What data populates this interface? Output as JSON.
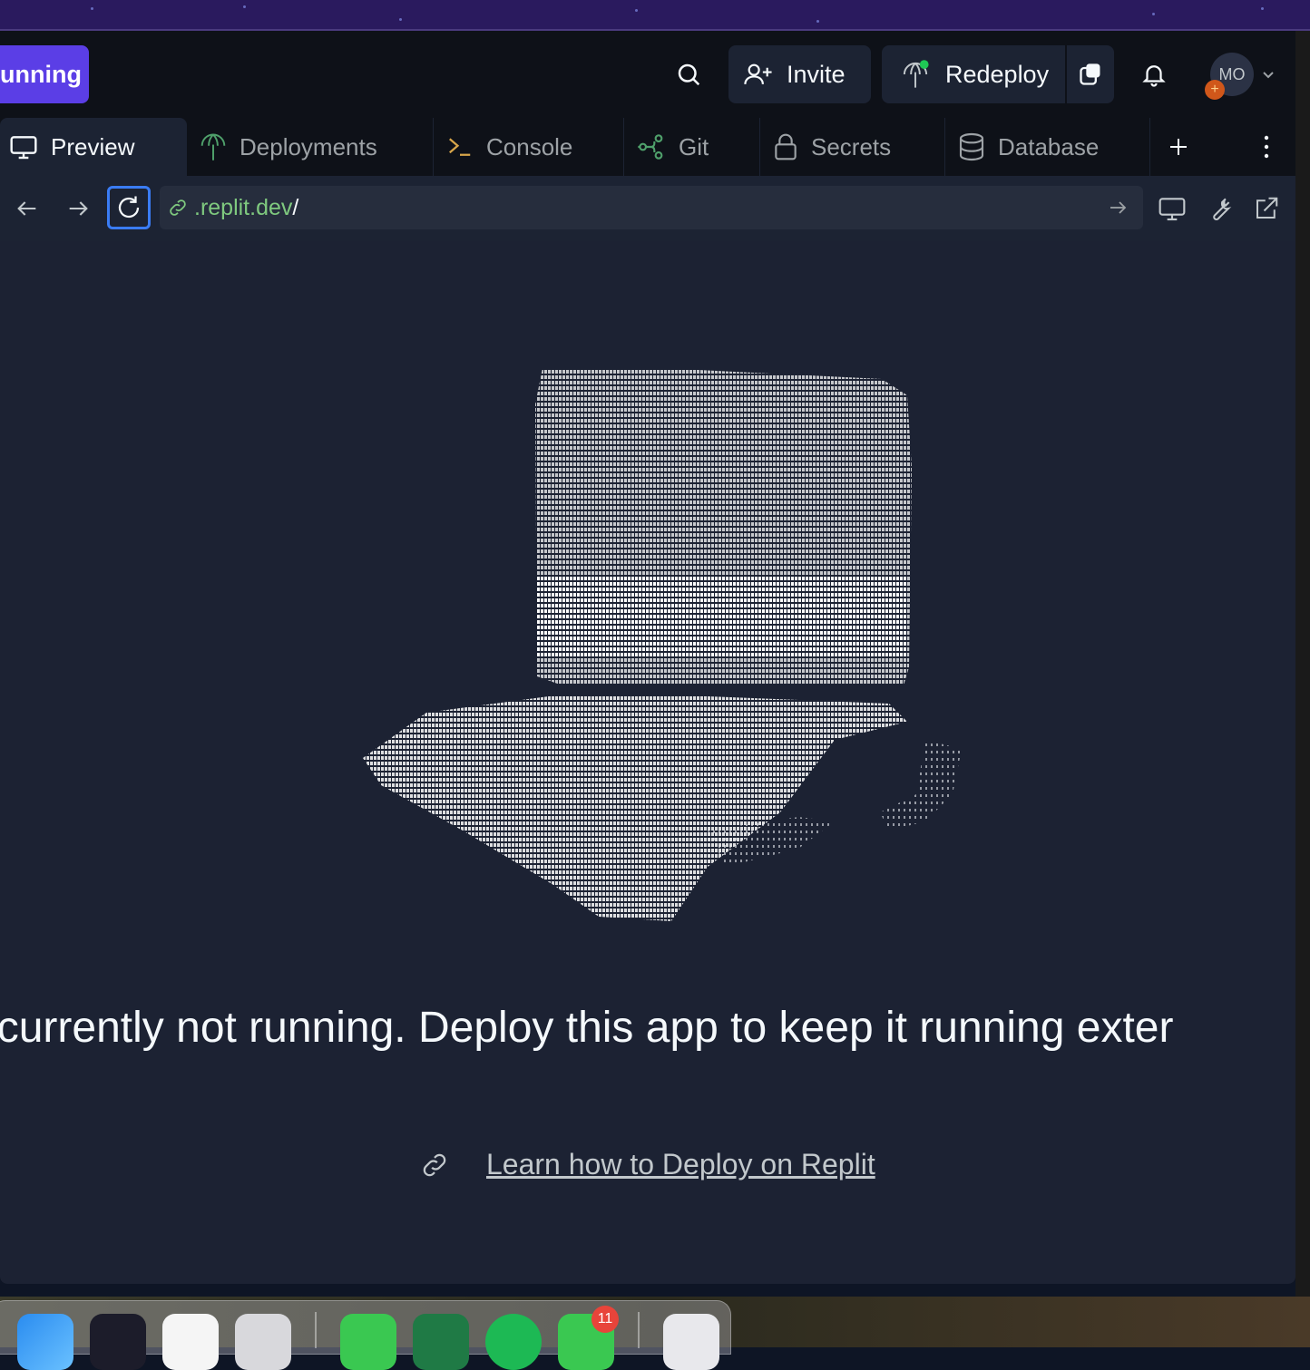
{
  "header": {
    "run_label": "unning",
    "invite_label": "Invite",
    "redeploy_label": "Redeploy",
    "avatar_initials": "MO",
    "avatar_badge": "+"
  },
  "tabs": [
    {
      "label": "Preview",
      "icon": "monitor-icon",
      "active": true
    },
    {
      "label": "Deployments",
      "icon": "deploy-icon",
      "active": false
    },
    {
      "label": "Console",
      "icon": "terminal-icon",
      "active": false
    },
    {
      "label": "Git",
      "icon": "git-icon",
      "active": false
    },
    {
      "label": "Secrets",
      "icon": "lock-icon",
      "active": false
    },
    {
      "label": "Database",
      "icon": "database-icon",
      "active": false
    }
  ],
  "urlbar": {
    "url": ".replit.dev",
    "url_suffix": "/"
  },
  "preview": {
    "message": "pp is currently not running. Deploy this app to keep it running exter",
    "learn_link": "Learn how to Deploy on Replit"
  },
  "dock": {
    "badge_count": "11"
  },
  "colors": {
    "accent": "#5b3ee6",
    "url_green": "#7fc97f",
    "focus_blue": "#3a7cf5",
    "preview_bg": "#1c2233"
  }
}
